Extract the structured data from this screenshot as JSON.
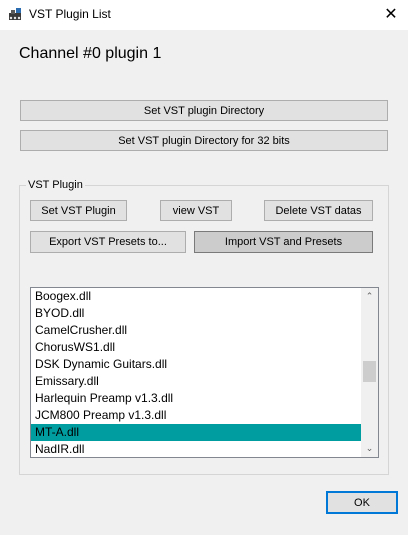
{
  "window": {
    "title": "VST Plugin List",
    "close_glyph": "✕"
  },
  "heading": "Channel #0 plugin 1",
  "buttons": {
    "set_dir": "Set VST plugin Directory",
    "set_dir_32": "Set VST plugin Directory for 32 bits",
    "set_plugin": "Set VST Plugin",
    "view_vst": "view VST",
    "delete_datas": "Delete VST datas",
    "export_presets": "Export VST Presets to...",
    "import_presets": "Import VST and Presets",
    "ok": "OK"
  },
  "group": {
    "label": "VST Plugin"
  },
  "plugins": {
    "items": [
      "Boogex.dll",
      "BYOD.dll",
      "CamelCrusher.dll",
      "ChorusWS1.dll",
      "DSK Dynamic Guitars.dll",
      "Emissary.dll",
      "Harlequin Preamp v1.3.dll",
      "JCM800 Preamp v1.3.dll",
      "MT-A.dll",
      "NadIR.dll"
    ],
    "selected": "MT-A.dll"
  },
  "scrollbar": {
    "up": "⌃",
    "down": "⌄"
  },
  "colors": {
    "selection": "#009da0",
    "accent": "#0078d7"
  },
  "icons": {
    "app": "app-logo-icon",
    "close": "close-icon"
  }
}
